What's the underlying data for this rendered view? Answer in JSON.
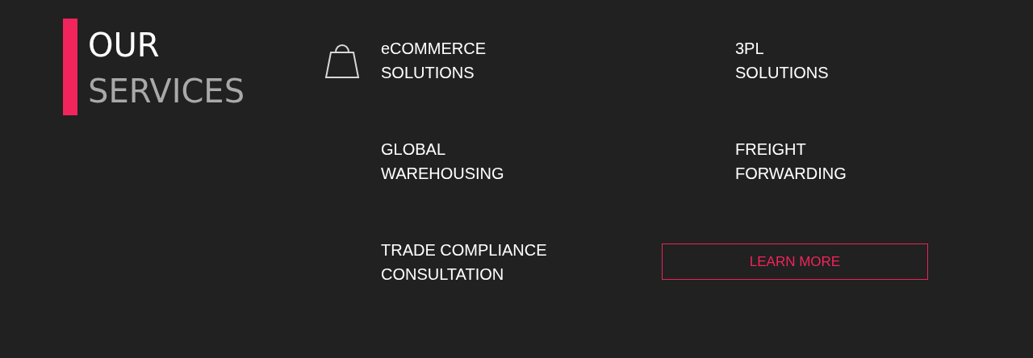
{
  "heading": {
    "line_1": "OUR",
    "line_2": "SERVICES"
  },
  "services": [
    {
      "kind": "bag",
      "lines": [
        "eCOMMERCE",
        "SOLUTIONS"
      ]
    },
    {
      "kind": "plain",
      "lines": [
        "3PL",
        "SOLUTIONS"
      ]
    },
    {
      "kind": "plain",
      "lines": [
        "GLOBAL",
        "WAREHOUSING"
      ]
    },
    {
      "kind": "plain",
      "lines": [
        "FREIGHT",
        "FORWARDING"
      ]
    },
    {
      "kind": "plain",
      "lines": [
        "TRADE COMPLIANCE",
        "CONSULTATION"
      ]
    }
  ],
  "button": {
    "label": "LEARN MORE"
  }
}
